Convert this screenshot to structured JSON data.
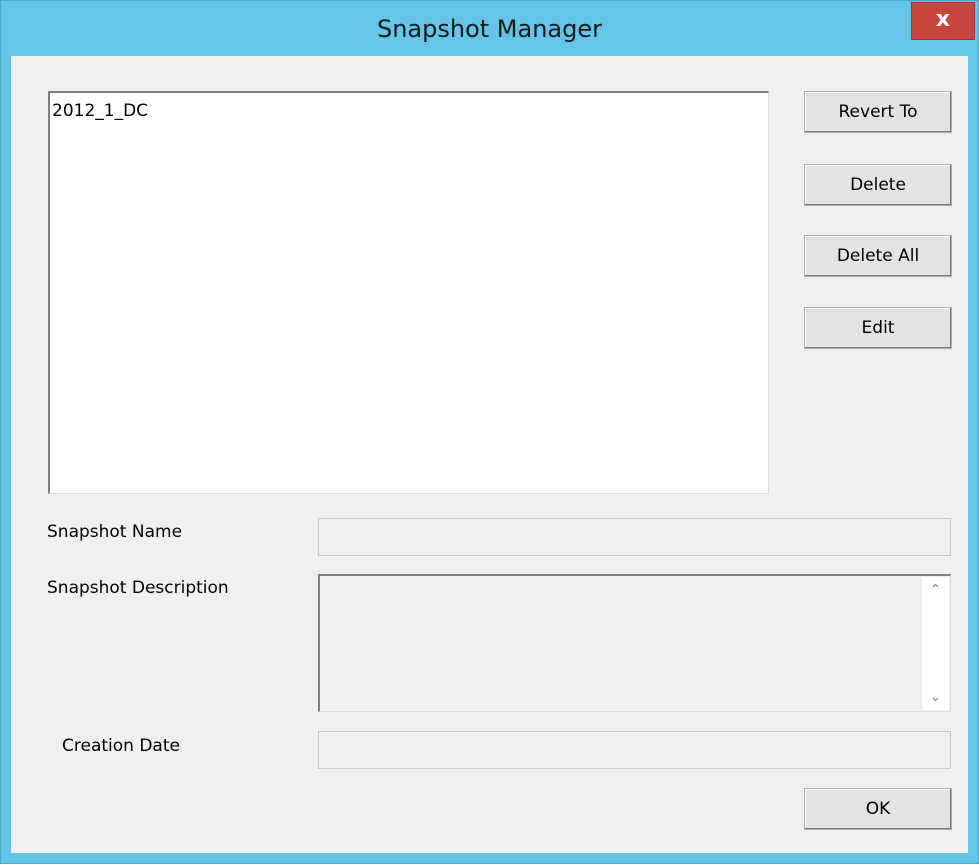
{
  "window": {
    "title": "Snapshot Manager",
    "close_label": "x"
  },
  "snapshots": {
    "items": [
      "2012_1_DC"
    ]
  },
  "buttons": {
    "revert_to": "Revert To",
    "delete": "Delete",
    "delete_all": "Delete All",
    "edit": "Edit",
    "ok": "OK"
  },
  "fields": {
    "name_label": "Snapshot Name",
    "name_value": "",
    "description_label": "Snapshot Description",
    "description_value": "",
    "creation_date_label": "Creation Date",
    "creation_date_value": ""
  },
  "colors": {
    "title_bar": "#64c5e8",
    "close_button": "#c8463d",
    "dialog_background": "#f0f0f0"
  },
  "icons": {
    "close": "close-icon",
    "scroll_up": "chevron-up-icon",
    "scroll_down": "chevron-down-icon"
  }
}
